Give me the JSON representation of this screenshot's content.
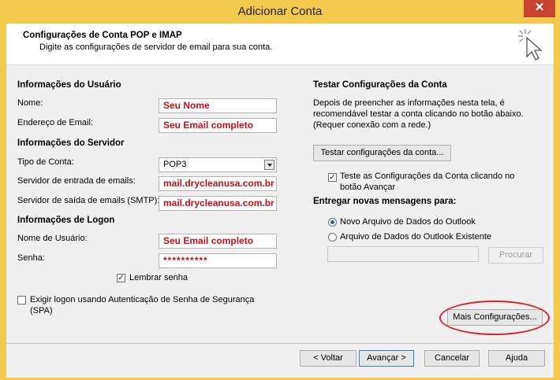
{
  "window": {
    "title": "Adicionar Conta",
    "close_glyph": "✕"
  },
  "header": {
    "title": "Configurações de Conta POP e IMAP",
    "subtitle": "Digite as configurações de servidor de email para sua conta."
  },
  "user_info": {
    "heading": "Informações do Usuário",
    "name_label": "Nome:",
    "name_value": "Seu Nome",
    "email_label": "Endereço de Email:",
    "email_value": "Seu Email completo"
  },
  "server_info": {
    "heading": "Informações do Servidor",
    "account_type_label": "Tipo de Conta:",
    "account_type_value": "POP3",
    "incoming_label": "Servidor de entrada de emails:",
    "incoming_value": "mail.drycleanusa.com.br",
    "outgoing_label": "Servidor de saída de emails (SMTP):",
    "outgoing_value": "mail.drycleanusa.com.br"
  },
  "logon_info": {
    "heading": "Informações de Logon",
    "username_label": "Nome de Usuário:",
    "username_value": "Seu Email completo",
    "password_label": "Senha:",
    "password_value": "**********",
    "remember_label": "Lembrar senha",
    "remember_checked": true,
    "spa_label_1": "Exigir logon usando Autenticação de Senha de Segurança",
    "spa_label_2": "(SPA)",
    "spa_checked": false
  },
  "test_settings": {
    "heading": "Testar Configurações da Conta",
    "desc_1": "Depois de preencher as informações nesta tela, é",
    "desc_2": "recomendável testar a conta clicando no botão abaixo.",
    "desc_3": "(Requer conexão com a rede.)",
    "test_button": "Testar configurações da conta...",
    "auto_test_label_1": "Teste as Configurações da Conta clicando no",
    "auto_test_label_2": "botão Avançar",
    "auto_test_checked": true
  },
  "deliver": {
    "heading": "Entregar novas mensagens para:",
    "option_new": "Novo Arquivo de Dados do Outlook",
    "option_existing": "Arquivo de Dados do Outlook Existente",
    "selected": "new",
    "browse_button": "Procurar"
  },
  "more_settings_button": "Mais Configurações...",
  "footer": {
    "back": "< Voltar",
    "next": "Avançar >",
    "cancel": "Cancelar",
    "help": "Ajuda"
  },
  "colors": {
    "frame": "#f2c94c",
    "highlight_text": "#c0121d",
    "annotation": "#d9242b"
  }
}
